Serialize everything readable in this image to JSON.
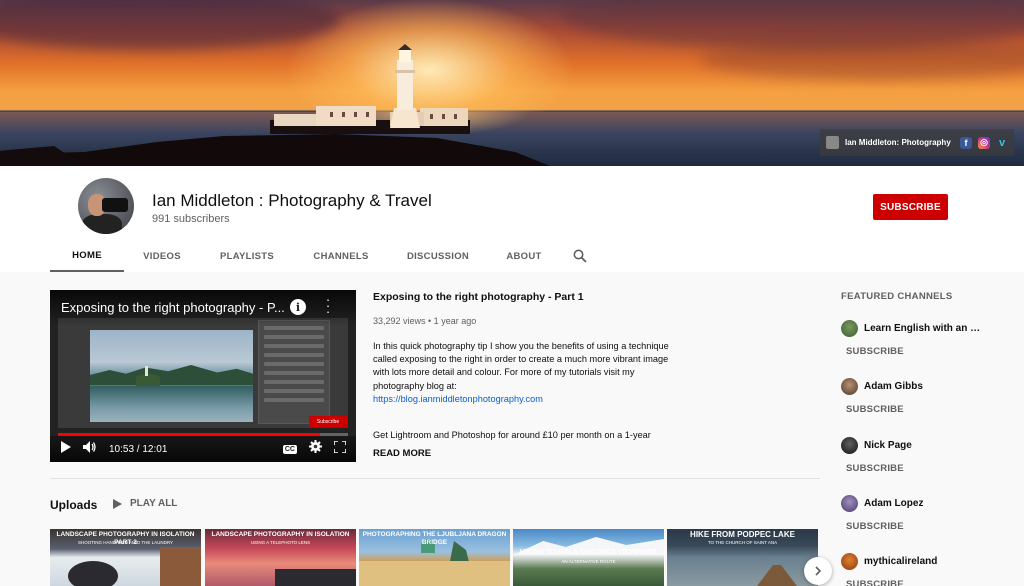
{
  "banner": {
    "social_name": "Ian Middleton: Photography",
    "social_icons": [
      "facebook-icon",
      "instagram-icon",
      "vimeo-icon"
    ]
  },
  "channel": {
    "title": "Ian Middleton : Photography & Travel",
    "subscribers": "991 subscribers",
    "subscribe_label": "SUBSCRIBE"
  },
  "tabs": [
    {
      "label": "HOME",
      "active": true
    },
    {
      "label": "VIDEOS"
    },
    {
      "label": "PLAYLISTS"
    },
    {
      "label": "CHANNELS"
    },
    {
      "label": "DISCUSSION"
    },
    {
      "label": "ABOUT"
    }
  ],
  "featured_video": {
    "player_title": "Exposing to the right photography - P...",
    "title": "Exposing to the right photography - Part 1",
    "meta": "33,292 views • 1 year ago",
    "description": "In this quick photography tip I show you the benefits of using a technique called exposing to the right in order to create a much more vibrant image with lots more detail and colour. For more of my tutorials visit my photography blog at:",
    "link": "https://blog.ianmiddletonphotography.com",
    "description2": "Get Lightroom and Photoshop for around £10 per month on a 1-year",
    "read_more": "READ MORE",
    "time": "10:53 / 12:01",
    "progress": 0.905,
    "cc_label": "CC",
    "overlay_subscribe": "Subscribe"
  },
  "uploads": {
    "title": "Uploads",
    "play_all": "PLAY ALL",
    "thumbs": [
      {
        "title": "LANDSCAPE PHOTOGRAPHY IN ISOLATION PART 2",
        "subtitle": "SHOOTING HANDHELD AMID THE LAUNDRY"
      },
      {
        "title": "LANDSCAPE PHOTOGRAPHY IN ISOLATION",
        "subtitle": "USING A TELEPHOTO LENS"
      },
      {
        "title": "PHOTOGRAPHING THE LJUBLJANA DRAGON BRIDGE",
        "subtitle": ""
      },
      {
        "title": "HIKING TO MALA OSOJNICA VIEWPOINT",
        "subtitle": "AN ALTERNATIVE ROUTE"
      },
      {
        "title": "HIKE FROM PODPEC LAKE",
        "subtitle": "TO THE CHURCH OF SAINT ANA"
      }
    ]
  },
  "featured_channels": {
    "title": "FEATURED CHANNELS",
    "subscribe_label": "SUBSCRIBE",
    "items": [
      {
        "name": "Learn English with an E..."
      },
      {
        "name": "Adam Gibbs"
      },
      {
        "name": "Nick Page"
      },
      {
        "name": "Adam Lopez"
      },
      {
        "name": "mythicalireland"
      }
    ]
  },
  "colors": {
    "subscribe_red": "#cc0000",
    "link_blue": "#065fd4",
    "progress_red": "#ff0000"
  }
}
